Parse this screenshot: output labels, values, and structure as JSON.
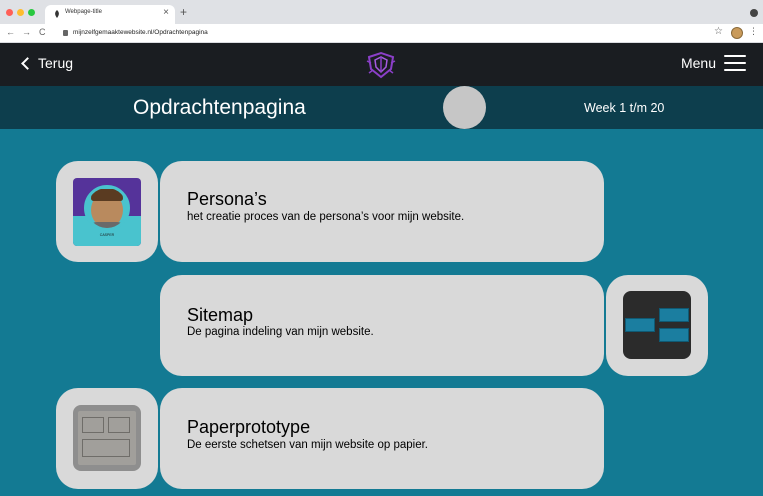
{
  "browser": {
    "tab_title": "Webpage-title",
    "url": "mijnzelfgemaaktewebsite.nl/Opdrachtenpagina",
    "nav_back": "←",
    "nav_forward": "→",
    "nav_reload": "C",
    "star": "☆",
    "kebab": "⋮",
    "tab_close": "×",
    "new_tab": "+"
  },
  "header": {
    "back_label": "Terug",
    "menu_label": "Menu"
  },
  "titlebar": {
    "title": "Opdrachtenpagina",
    "week": "Week 1 t/m 20"
  },
  "cards": [
    {
      "title": "Persona’s",
      "description": "het creatie proces van de persona’s voor mijn website.",
      "image_label": "CASPER"
    },
    {
      "title": "Sitemap",
      "description": "De pagina indeling van mijn website."
    },
    {
      "title": "Paperprototype",
      "description": "De eerste schetsen van mijn website op papier."
    }
  ],
  "colors": {
    "page_bg": "#137a93",
    "header_bg": "#1a1d21",
    "titlebar_bg": "#0d3e4d",
    "card_bg": "#d9d9d9",
    "logo_accent": "#8b3fc8"
  }
}
